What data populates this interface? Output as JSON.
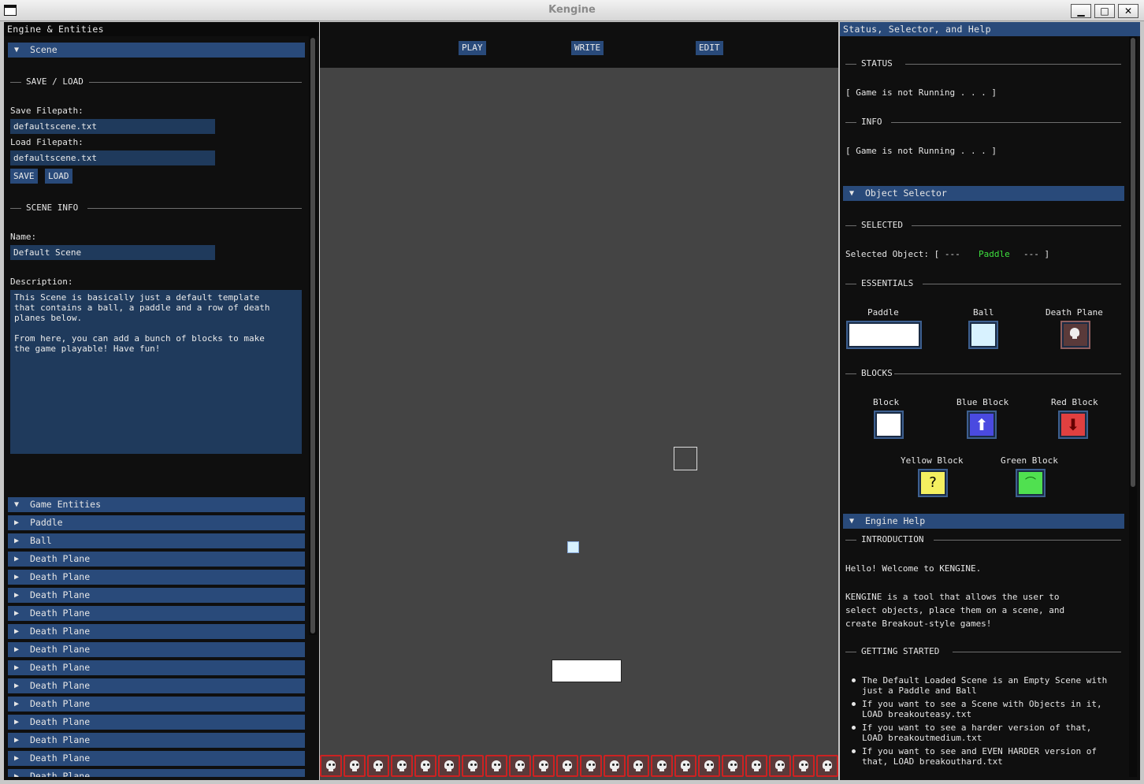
{
  "window": {
    "title": "Kengine",
    "minimize": "▁",
    "maximize": "□",
    "close": "✕"
  },
  "left": {
    "title": "Engine & Entities",
    "scene_header": "Scene",
    "save_load_sep": "SAVE / LOAD",
    "save_label": "Save Filepath:",
    "save_value": "defaultscene.txt",
    "load_label": "Load Filepath:",
    "load_value": "defaultscene.txt",
    "save_button": "SAVE",
    "load_button": "LOAD",
    "scene_info_sep": "SCENE INFO",
    "name_label": "Name:",
    "name_value": "Default Scene",
    "desc_label": "Description:",
    "desc_value": "This Scene is basically just a default template\nthat contains a ball, a paddle and a row of death\nplanes below.\n\nFrom here, you can add a bunch of blocks to make\nthe game playable! Have fun!",
    "entities_header": "Game Entities",
    "entities": [
      "Paddle",
      "Ball",
      "Death Plane",
      "Death Plane",
      "Death Plane",
      "Death Plane",
      "Death Plane",
      "Death Plane",
      "Death Plane",
      "Death Plane",
      "Death Plane",
      "Death Plane",
      "Death Plane",
      "Death Plane",
      "Death Plane"
    ]
  },
  "toolbar": {
    "play": "PLAY",
    "write": "WRITE",
    "edit": "EDIT"
  },
  "game": {
    "skull_count": 22
  },
  "right": {
    "title": "Status, Selector, and Help",
    "status_sep": "STATUS",
    "status_text": "[ Game is not Running . . . ]",
    "info_sep": "INFO",
    "info_text": "[ Game is not Running . . . ]",
    "selector_header": "Object Selector",
    "selected_sep": "SELECTED",
    "selected_prefix": "Selected Object: [ ---",
    "selected_value": "Paddle",
    "selected_suffix": "--- ]",
    "essentials_sep": "ESSENTIALS",
    "essentials": [
      "Paddle",
      "Ball",
      "Death Plane"
    ],
    "blocks_sep": "BLOCKS",
    "blocks": [
      "Block",
      "Blue Block",
      "Red Block",
      "Yellow Block",
      "Green Block"
    ],
    "help_header": "Engine Help",
    "intro_sep": "INTRODUCTION",
    "intro_1": "Hello! Welcome to KENGINE.",
    "intro_2": "KENGINE is a tool that allows the user to\nselect objects, place them on a scene, and\ncreate Breakout-style games!",
    "started_sep": "GETTING STARTED",
    "bullets": [
      "The Default Loaded Scene is an Empty Scene with\njust a Paddle and Ball",
      "If you want to see a Scene with Objects in it,\nLOAD breakouteasy.txt",
      "If you want to see a harder version of that,\nLOAD breakoutmedium.txt",
      "If you want to see and EVEN HARDER version of\nthat, LOAD breakouthard.txt"
    ]
  },
  "colors": {
    "header": "#294a7a",
    "frame": "#1f3a5c",
    "game_bg": "#444444",
    "selected": "#3ee03e",
    "death_border": "#cc2222"
  }
}
